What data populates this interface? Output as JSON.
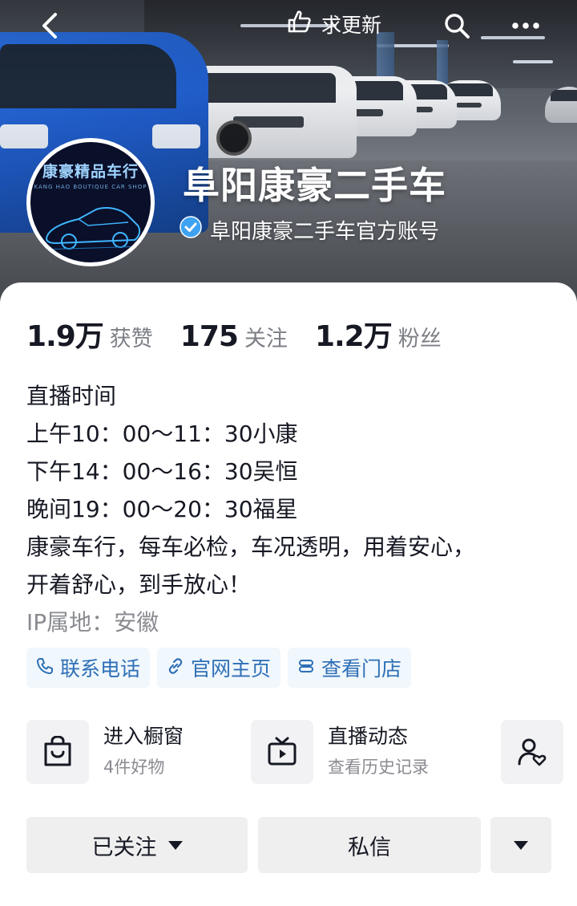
{
  "header": {
    "update_label": "求更新",
    "icons": [
      "back-icon",
      "hand-icon",
      "search-icon",
      "more-icon"
    ]
  },
  "profile": {
    "avatar": {
      "brand_text": "康豪精品车行",
      "brand_sub": "KANG HAO BOUTIQUE CAR SHOP"
    },
    "name": "阜阳康豪二手车",
    "verified_text": "阜阳康豪二手车官方账号"
  },
  "stats": [
    {
      "num": "1.9万",
      "label": "获赞"
    },
    {
      "num": "175",
      "label": "关注"
    },
    {
      "num": "1.2万",
      "label": "粉丝"
    }
  ],
  "bio": {
    "lines": [
      "直播时间",
      "上午10：00～11：30小康",
      "下午14：00～16：30吴恒",
      "晚间19：00～20：30福星",
      "康豪车行，每车必检，车况透明，用着安心，",
      "开着舒心，到手放心！"
    ],
    "ip": "IP属地：安徽"
  },
  "links": [
    {
      "label": "联系电话",
      "icon": "phone-icon"
    },
    {
      "label": "官网主页",
      "icon": "link-icon"
    },
    {
      "label": "查看门店",
      "icon": "store-icon"
    }
  ],
  "entries": [
    {
      "title": "进入橱窗",
      "subtitle": "4件好物",
      "icon": "shopping-bag-icon"
    },
    {
      "title": "直播动态",
      "subtitle": "查看历史记录",
      "icon": "tv-icon"
    }
  ],
  "actions": {
    "follow_label": "已关注",
    "message_label": "私信"
  },
  "colors": {
    "accent": "#2e6fb5",
    "verified": "#3ea2f2"
  }
}
